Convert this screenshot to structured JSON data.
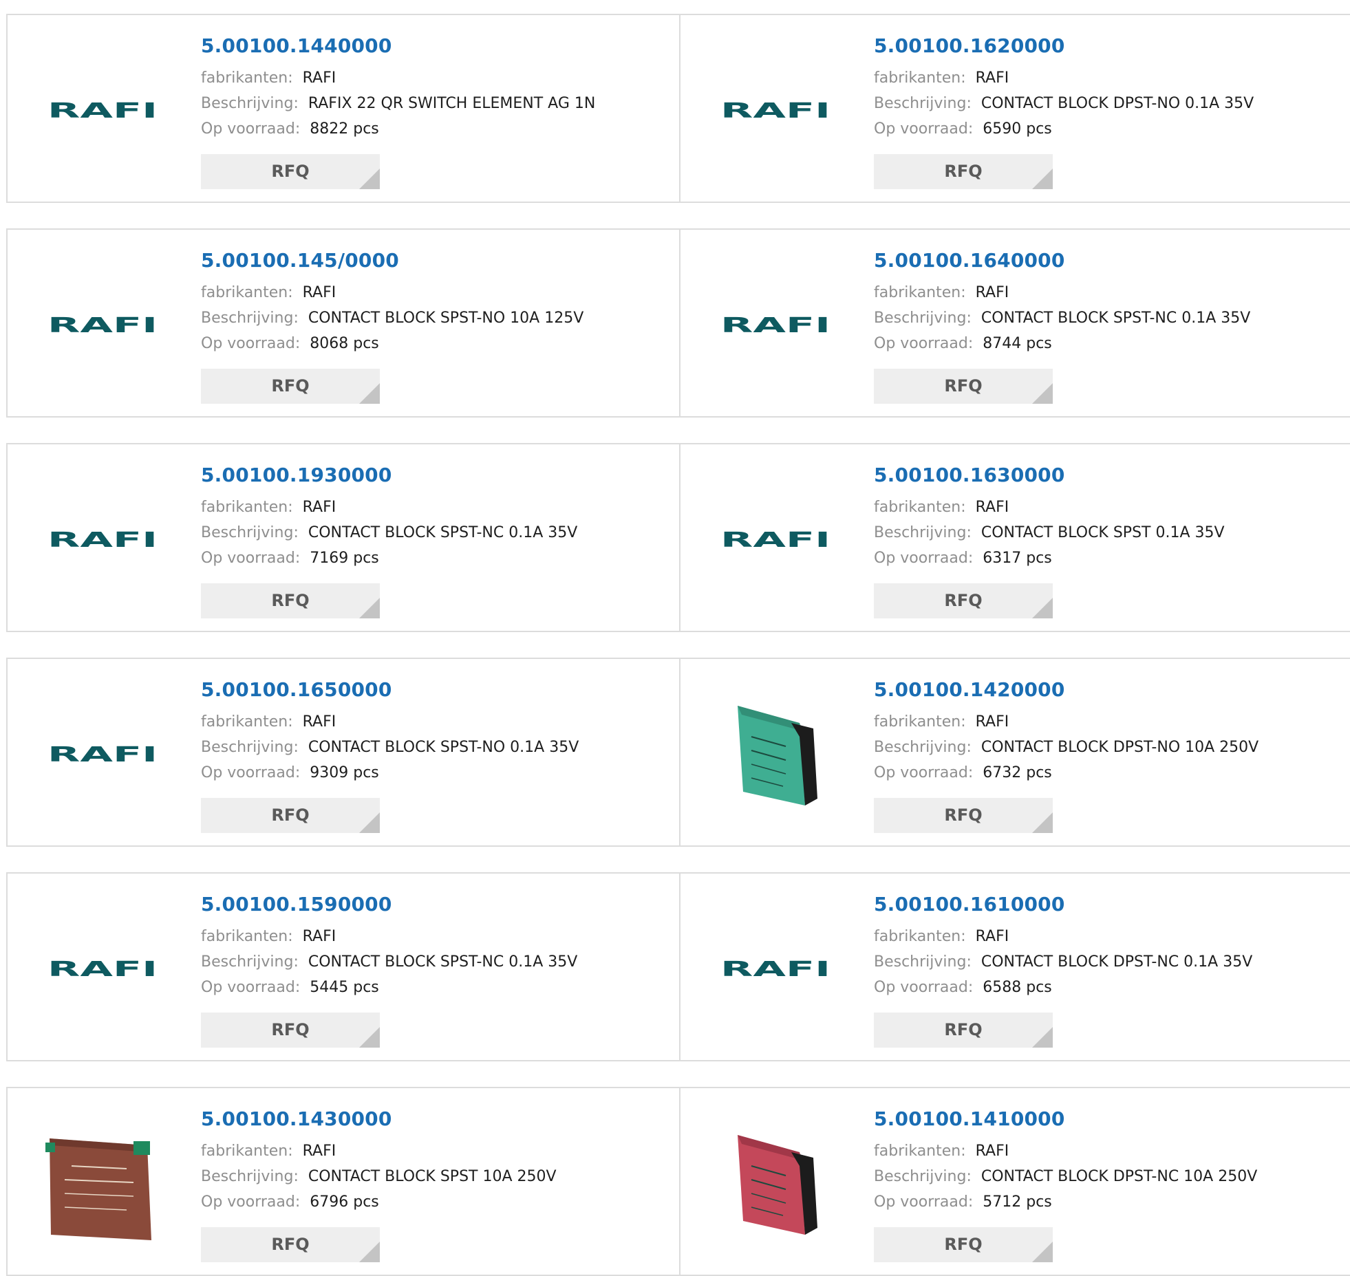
{
  "labels": {
    "manufacturer": "fabrikanten:",
    "description": "Beschrijving:",
    "stock": "Op voorraad:",
    "rfq": "RFQ",
    "logo_text": "RAFI"
  },
  "colors": {
    "part_link": "#1a6db3",
    "logo": "#0e5a60",
    "border": "#dcdcdc",
    "button_bg": "#eeeeee"
  },
  "rows": [
    [
      {
        "part": "5.00100.1440000",
        "manufacturer": "RAFI",
        "description": "RAFIX 22 QR SWITCH ELEMENT AG 1N",
        "stock": "8822 pcs",
        "image": "rafi-logo"
      },
      {
        "part": "5.00100.1620000",
        "manufacturer": "RAFI",
        "description": "CONTACT BLOCK DPST-NO 0.1A 35V",
        "stock": "6590 pcs",
        "image": "rafi-logo"
      }
    ],
    [
      {
        "part": "5.00100.145/0000",
        "manufacturer": "RAFI",
        "description": "CONTACT BLOCK SPST-NO 10A 125V",
        "stock": "8068 pcs",
        "image": "rafi-logo"
      },
      {
        "part": "5.00100.1640000",
        "manufacturer": "RAFI",
        "description": "CONTACT BLOCK SPST-NC 0.1A 35V",
        "stock": "8744 pcs",
        "image": "rafi-logo"
      }
    ],
    [
      {
        "part": "5.00100.1930000",
        "manufacturer": "RAFI",
        "description": "CONTACT BLOCK SPST-NC 0.1A 35V",
        "stock": "7169 pcs",
        "image": "rafi-logo"
      },
      {
        "part": "5.00100.1630000",
        "manufacturer": "RAFI",
        "description": "CONTACT BLOCK SPST 0.1A 35V",
        "stock": "6317 pcs",
        "image": "rafi-logo"
      }
    ],
    [
      {
        "part": "5.00100.1650000",
        "manufacturer": "RAFI",
        "description": "CONTACT BLOCK SPST-NO 0.1A 35V",
        "stock": "9309 pcs",
        "image": "rafi-logo"
      },
      {
        "part": "5.00100.1420000",
        "manufacturer": "RAFI",
        "description": "CONTACT BLOCK DPST-NO 10A 250V",
        "stock": "6732 pcs",
        "image": "green-contact-block-photo"
      }
    ],
    [
      {
        "part": "5.00100.1590000",
        "manufacturer": "RAFI",
        "description": "CONTACT BLOCK SPST-NC 0.1A 35V",
        "stock": "5445 pcs",
        "image": "rafi-logo"
      },
      {
        "part": "5.00100.1610000",
        "manufacturer": "RAFI",
        "description": "CONTACT BLOCK DPST-NC 0.1A 35V",
        "stock": "6588 pcs",
        "image": "rafi-logo"
      }
    ],
    [
      {
        "part": "5.00100.1430000",
        "manufacturer": "RAFI",
        "description": "CONTACT BLOCK SPST 10A 250V",
        "stock": "6796 pcs",
        "image": "brown-contact-block-photo"
      },
      {
        "part": "5.00100.1410000",
        "manufacturer": "RAFI",
        "description": "CONTACT BLOCK DPST-NC 10A 250V",
        "stock": "5712 pcs",
        "image": "red-contact-block-photo"
      }
    ]
  ]
}
